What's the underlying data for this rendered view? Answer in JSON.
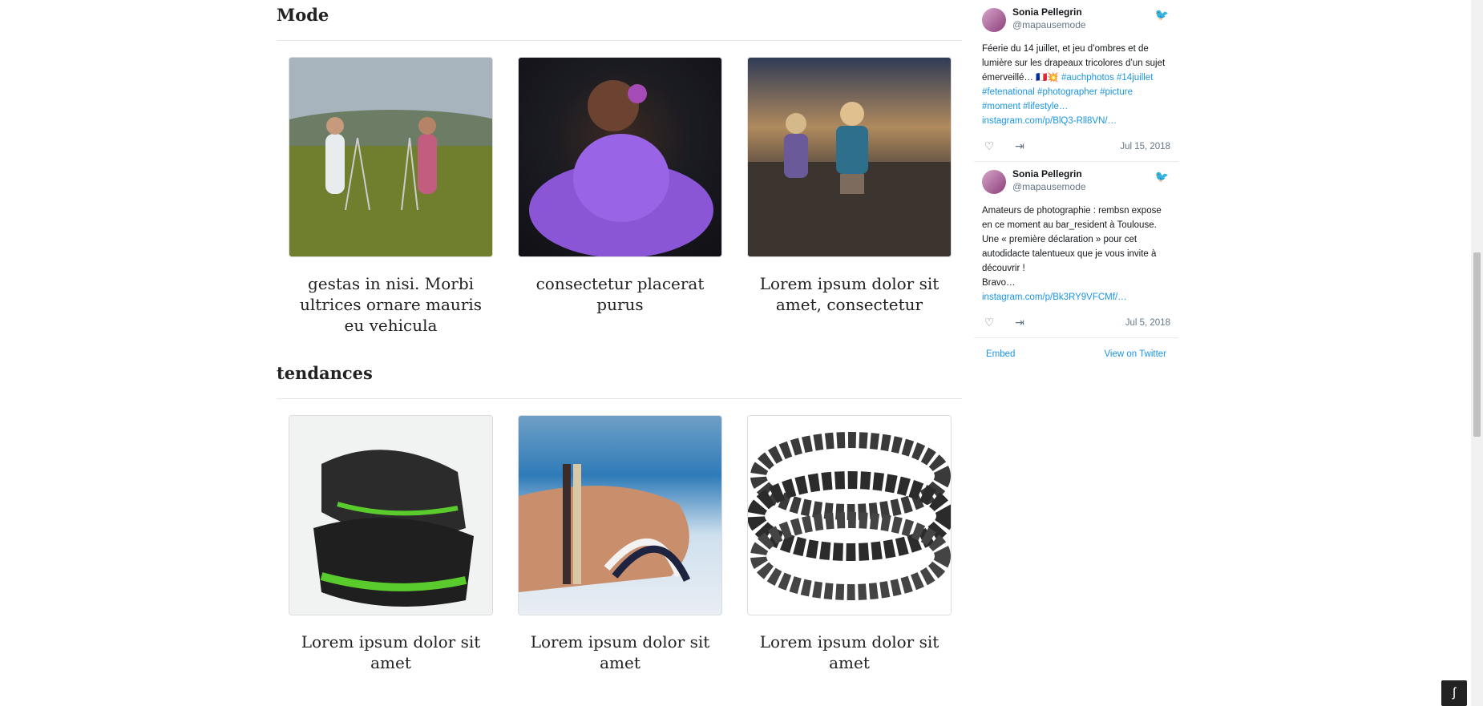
{
  "sections": [
    {
      "title": "Mode",
      "cards": [
        {
          "caption": "gestas in nisi. Morbi ultrices ornare mauris eu vehicula",
          "image": "children-photographing-field"
        },
        {
          "caption": "consectetur placerat purus",
          "image": "baby-purple-dress"
        },
        {
          "caption": "Lorem ipsum dolor sit amet, consectetur",
          "image": "kids-running-beach"
        }
      ]
    },
    {
      "title": "tendances",
      "cards": [
        {
          "caption": "Lorem ipsum dolor sit amet",
          "image": "green-sneakers"
        },
        {
          "caption": "Lorem ipsum dolor sit amet",
          "image": "hand-bracelets-sea"
        },
        {
          "caption": "Lorem ipsum dolor sit amet",
          "image": "black-bead-bracelets"
        }
      ]
    }
  ],
  "timeline": {
    "tweets": [
      {
        "name": "Sonia Pellegrin",
        "handle": "@mapausemode",
        "text": "Féerie du 14 juillet, et jeu d’ombres et de lumière sur les drapeaux tricolores d’un sujet émerveillé… 🇫🇷💥",
        "links": "#auchphotos #14juillet #fetenational #photographer #picture #moment #lifestyle…",
        "url": "instagram.com/p/BlQ3-Rll8VN/…",
        "date": "Jul 15, 2018"
      },
      {
        "name": "Sonia Pellegrin",
        "handle": "@mapausemode",
        "text": "Amateurs de photographie : rembsn expose en ce moment au bar_resident à Toulouse. Une « première déclaration » pour cet autodidacte talentueux que je vous invite à découvrir !",
        "text2": "Bravo…",
        "url": "instagram.com/p/Bk3RY9VFCMf/…",
        "date": "Jul 5, 2018"
      }
    ],
    "embed_label": "Embed",
    "view_label": "View on Twitter"
  },
  "icons": {
    "like": "heart-icon",
    "share": "share-icon",
    "twitter": "twitter-bird-icon",
    "symfony": "symfony-icon"
  }
}
